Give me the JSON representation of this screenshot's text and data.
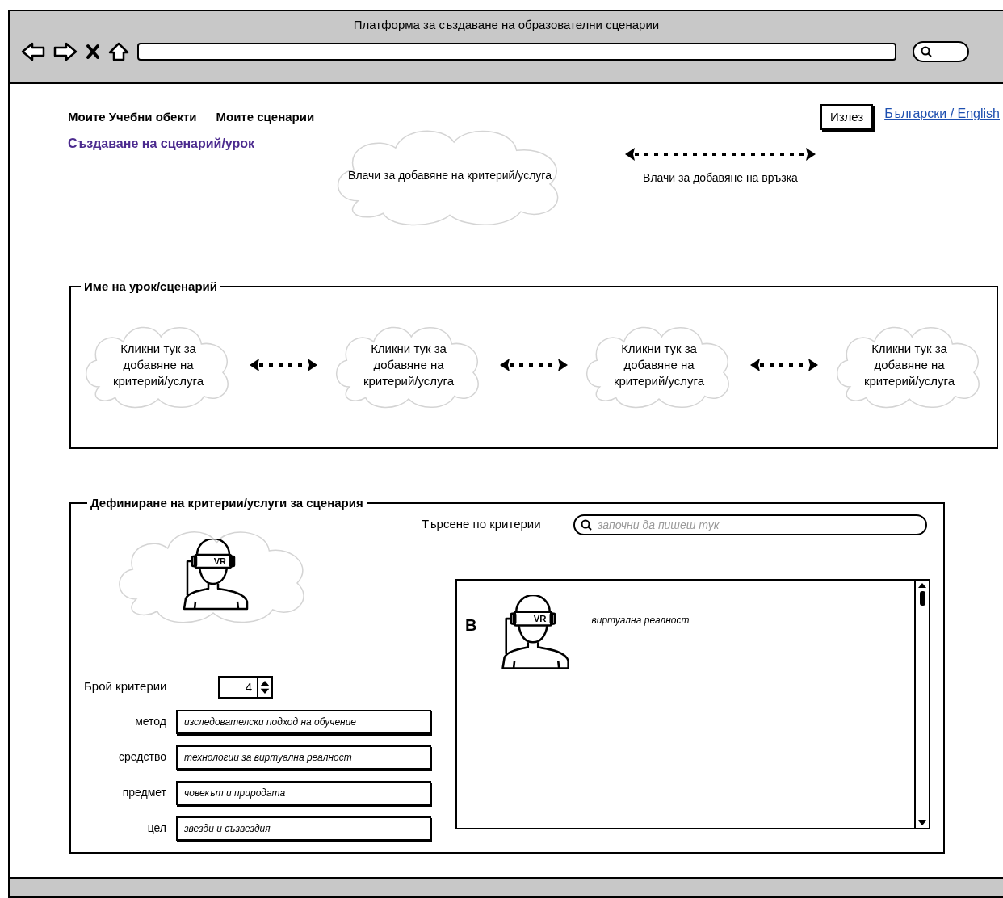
{
  "window": {
    "title": "Платформа за създаване на образователни сценарии"
  },
  "nav": {
    "links": [
      "Моите Учебни обекти",
      "Моите сценарии"
    ],
    "logout": "Излез",
    "language": "Български / English"
  },
  "page_title": "Създаване на сценарий/урок",
  "palette": {
    "cloud": "Влачи за добавяне на критерий/услуга",
    "link": "Влачи за добавяне на връзка"
  },
  "scenario": {
    "legend": "Име на урок/сценарий",
    "steps": [
      {
        "label": "Кликни тук за добавяне на критерий/услуга"
      },
      {
        "label": "Кликни тук за добавяне на критерий/услуга"
      },
      {
        "label": "Кликни тук за добавяне на критерий/услуга"
      },
      {
        "label": "Кликни тук за добавяне на критерий/услуга"
      }
    ]
  },
  "criteria": {
    "legend": "Дефиниране на критерии/услуги за сценария",
    "preview_badge": "VR",
    "count_label": "Брой критерии",
    "count": "4",
    "fields": [
      {
        "label": "метод",
        "value": "изследователски подход на обучение"
      },
      {
        "label": "средство",
        "value": "технологии за виртуална реалност"
      },
      {
        "label": "предмет",
        "value": "човекът и природата"
      },
      {
        "label": "цел",
        "value": "звезди и съзвездия"
      }
    ],
    "search": {
      "label": "Търсене по критерии",
      "placeholder": "започни да пишеш тук"
    },
    "results": [
      {
        "letter": "В",
        "badge": "VR",
        "title": "виртуална реалност"
      }
    ]
  }
}
